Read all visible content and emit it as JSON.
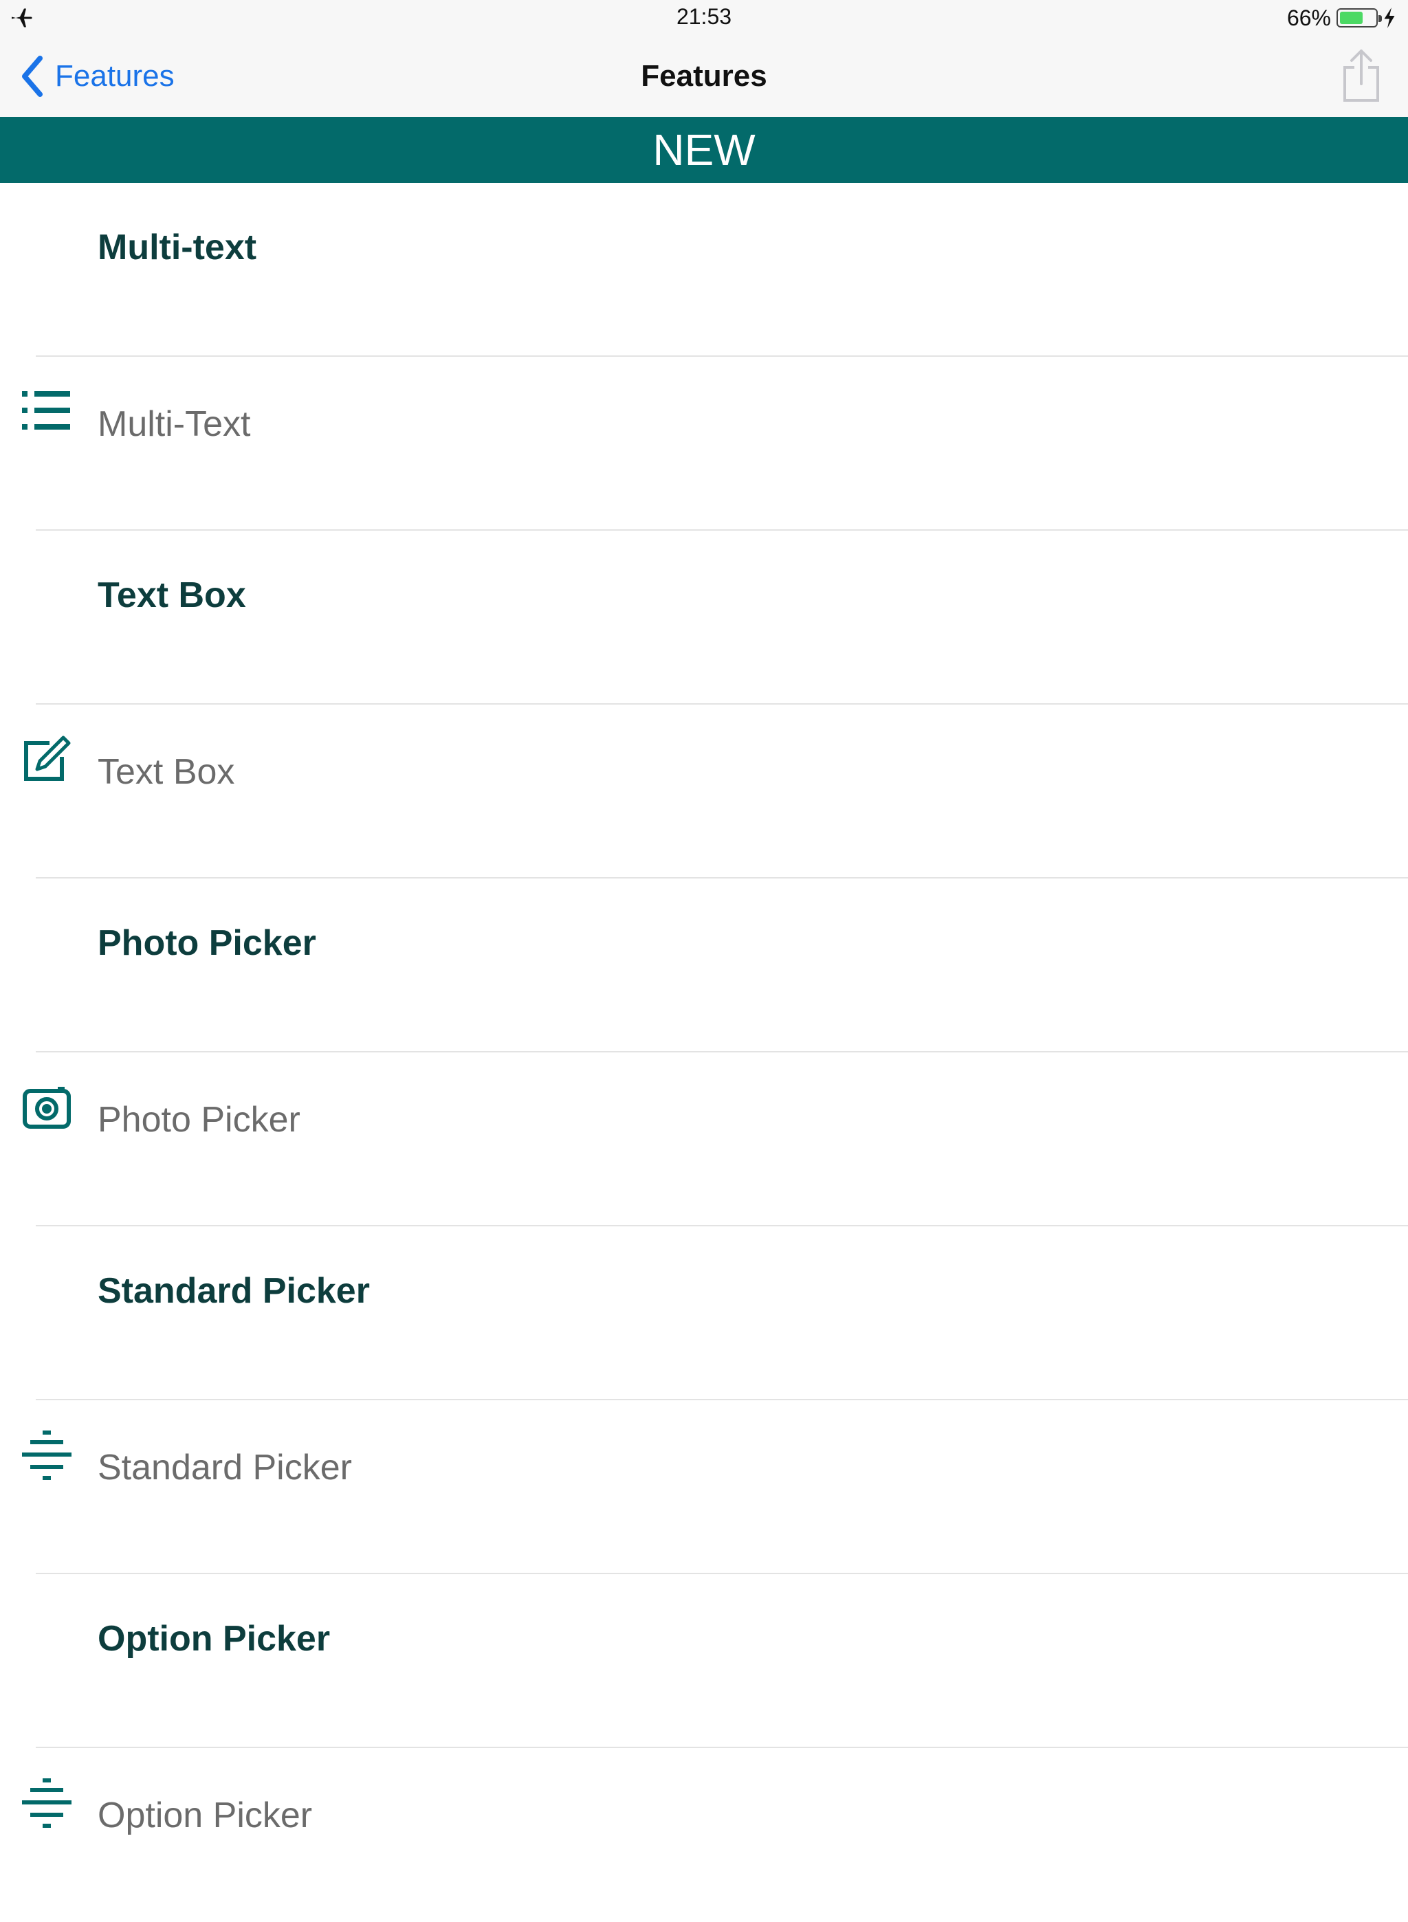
{
  "status_bar": {
    "time": "21:53",
    "battery_percent": "66%",
    "battery_level": 0.66,
    "icons": [
      "airplane-icon",
      "battery-icon",
      "charging-bolt-icon"
    ]
  },
  "nav": {
    "back_label": "Features",
    "title": "Features",
    "icons": [
      "chevron-left-icon",
      "share-icon"
    ]
  },
  "section": {
    "title": "NEW"
  },
  "colors": {
    "header_bg": "#036a6a",
    "accent_blue": "#1a73e8",
    "title_text": "#0d3d3d",
    "item_text": "#6b6b6b",
    "battery_green": "#4cd964"
  },
  "rows": [
    {
      "type": "title",
      "label": "Multi-text"
    },
    {
      "type": "item",
      "label": "Multi-Text",
      "icon": "list-icon"
    },
    {
      "type": "title",
      "label": "Text Box"
    },
    {
      "type": "item",
      "label": "Text Box",
      "icon": "edit-icon"
    },
    {
      "type": "title",
      "label": "Photo Picker"
    },
    {
      "type": "item",
      "label": "Photo Picker",
      "icon": "camera-icon"
    },
    {
      "type": "title",
      "label": "Standard Picker"
    },
    {
      "type": "item",
      "label": "Standard Picker",
      "icon": "picker-icon"
    },
    {
      "type": "title",
      "label": "Option Picker"
    },
    {
      "type": "item",
      "label": "Option Picker",
      "icon": "picker-icon"
    }
  ]
}
